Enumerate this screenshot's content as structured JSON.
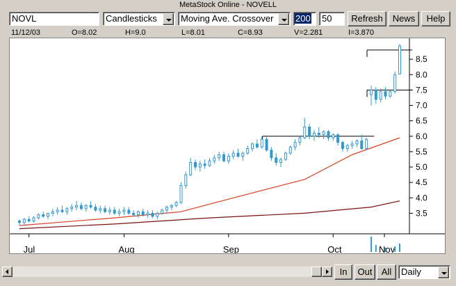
{
  "window": {
    "title": "MetaStock Online - NOVELL"
  },
  "toolbar": {
    "symbol": "NOVL",
    "chart_style": "Candlesticks",
    "indicator": "Moving Ave. Crossover",
    "period_long": "200",
    "period_short": "50",
    "refresh_label": "Refresh",
    "news_label": "News",
    "help_label": "Help"
  },
  "info_bar": {
    "date": "11/12/03",
    "open": "O=8.02",
    "high": "H=9.0",
    "low": "L=8.01",
    "close": "C=8.93",
    "volume": "V=2.281",
    "interest": "I=3.870"
  },
  "bottom_bar": {
    "in_label": "In",
    "out_label": "Out",
    "all_label": "All",
    "period": "Daily"
  },
  "colors": {
    "candle": "#3399cc",
    "ma_fast": "#d84020",
    "ma_slow": "#7a1010"
  },
  "chart_data": {
    "type": "candlestick",
    "title": "",
    "x_ticks": [
      "Jul",
      "Aug",
      "Sep",
      "Oct",
      "Nov"
    ],
    "y_ticks": [
      "8.5",
      "8.0",
      "7.5",
      "7.0",
      "6.5",
      "6.0",
      "5.5",
      "5.0",
      "4.5",
      "4.0",
      "3.5"
    ],
    "ylim": [
      2.9,
      9.0
    ],
    "grid": false,
    "candles": [
      [
        3.25,
        3.3,
        3.1,
        3.2
      ],
      [
        3.2,
        3.35,
        3.1,
        3.3
      ],
      [
        3.3,
        3.4,
        3.2,
        3.25
      ],
      [
        3.25,
        3.4,
        3.2,
        3.35
      ],
      [
        3.35,
        3.5,
        3.3,
        3.45
      ],
      [
        3.45,
        3.55,
        3.35,
        3.4
      ],
      [
        3.4,
        3.5,
        3.3,
        3.5
      ],
      [
        3.5,
        3.65,
        3.4,
        3.55
      ],
      [
        3.55,
        3.7,
        3.45,
        3.6
      ],
      [
        3.6,
        3.75,
        3.5,
        3.55
      ],
      [
        3.55,
        3.7,
        3.45,
        3.65
      ],
      [
        3.65,
        3.8,
        3.55,
        3.7
      ],
      [
        3.7,
        3.9,
        3.6,
        3.75
      ],
      [
        3.75,
        3.85,
        3.6,
        3.65
      ],
      [
        3.65,
        3.8,
        3.55,
        3.75
      ],
      [
        3.75,
        3.9,
        3.65,
        3.7
      ],
      [
        3.7,
        3.8,
        3.55,
        3.6
      ],
      [
        3.6,
        3.75,
        3.5,
        3.65
      ],
      [
        3.65,
        3.75,
        3.5,
        3.55
      ],
      [
        3.55,
        3.7,
        3.45,
        3.6
      ],
      [
        3.6,
        3.7,
        3.45,
        3.5
      ],
      [
        3.5,
        3.65,
        3.4,
        3.55
      ],
      [
        3.55,
        3.7,
        3.45,
        3.6
      ],
      [
        3.6,
        3.7,
        3.45,
        3.5
      ],
      [
        3.5,
        3.6,
        3.4,
        3.45
      ],
      [
        3.45,
        3.6,
        3.35,
        3.55
      ],
      [
        3.55,
        3.65,
        3.4,
        3.45
      ],
      [
        3.45,
        3.6,
        3.35,
        3.5
      ],
      [
        3.5,
        3.6,
        3.35,
        3.4
      ],
      [
        3.4,
        3.55,
        3.3,
        3.5
      ],
      [
        3.5,
        3.65,
        3.45,
        3.6
      ],
      [
        3.6,
        3.75,
        3.5,
        3.7
      ],
      [
        3.7,
        3.8,
        3.6,
        3.75
      ],
      [
        3.75,
        3.9,
        3.7,
        3.85
      ],
      [
        3.85,
        4.5,
        3.8,
        4.4
      ],
      [
        4.4,
        4.85,
        4.3,
        4.75
      ],
      [
        4.75,
        5.3,
        4.7,
        5.15
      ],
      [
        5.15,
        5.25,
        4.9,
        5.0
      ],
      [
        5.0,
        5.2,
        4.85,
        5.1
      ],
      [
        5.1,
        5.25,
        4.95,
        5.05
      ],
      [
        5.05,
        5.3,
        5.0,
        5.2
      ],
      [
        5.2,
        5.4,
        5.1,
        5.3
      ],
      [
        5.3,
        5.5,
        5.2,
        5.4
      ],
      [
        5.4,
        5.5,
        5.15,
        5.2
      ],
      [
        5.2,
        5.45,
        5.1,
        5.35
      ],
      [
        5.35,
        5.55,
        5.25,
        5.45
      ],
      [
        5.45,
        5.6,
        5.3,
        5.35
      ],
      [
        5.35,
        5.5,
        5.2,
        5.45
      ],
      [
        5.45,
        5.7,
        5.4,
        5.6
      ],
      [
        5.6,
        5.8,
        5.5,
        5.75
      ],
      [
        5.75,
        5.9,
        5.6,
        5.65
      ],
      [
        5.65,
        6.0,
        5.6,
        5.9
      ],
      [
        5.9,
        6.0,
        5.5,
        5.55
      ],
      [
        5.55,
        5.65,
        5.2,
        5.3
      ],
      [
        5.3,
        5.45,
        5.05,
        5.15
      ],
      [
        5.15,
        5.3,
        5.0,
        5.25
      ],
      [
        5.25,
        5.5,
        5.2,
        5.45
      ],
      [
        5.45,
        5.7,
        5.4,
        5.65
      ],
      [
        5.65,
        5.9,
        5.55,
        5.8
      ],
      [
        5.8,
        6.0,
        5.7,
        5.95
      ],
      [
        5.95,
        6.6,
        5.9,
        6.3
      ],
      [
        6.3,
        6.4,
        5.9,
        6.0
      ],
      [
        6.0,
        6.2,
        5.85,
        6.1
      ],
      [
        6.1,
        6.3,
        5.95,
        6.05
      ],
      [
        6.05,
        6.2,
        5.9,
        6.15
      ],
      [
        6.15,
        6.2,
        5.85,
        5.95
      ],
      [
        5.95,
        6.1,
        5.85,
        6.05
      ],
      [
        6.05,
        6.1,
        5.7,
        5.8
      ],
      [
        5.8,
        5.85,
        5.5,
        5.6
      ],
      [
        5.6,
        5.75,
        5.5,
        5.7
      ],
      [
        5.7,
        5.85,
        5.6,
        5.75
      ],
      [
        5.75,
        5.9,
        5.65,
        5.85
      ],
      [
        5.85,
        6.05,
        5.55,
        5.6
      ],
      [
        5.6,
        5.95,
        5.55,
        5.9
      ],
      [
        7.35,
        7.65,
        7.0,
        7.5
      ],
      [
        7.5,
        7.6,
        7.05,
        7.2
      ],
      [
        7.2,
        7.55,
        7.1,
        7.45
      ],
      [
        7.45,
        7.6,
        7.2,
        7.3
      ],
      [
        7.3,
        7.5,
        7.25,
        7.45
      ],
      [
        7.45,
        8.1,
        7.4,
        8.0
      ],
      [
        8.02,
        9.0,
        8.01,
        8.93
      ]
    ],
    "moving_average_fast": [
      [
        0,
        3.1
      ],
      [
        20,
        3.35
      ],
      [
        34,
        3.55
      ],
      [
        45,
        4.0
      ],
      [
        60,
        4.6
      ],
      [
        70,
        5.4
      ],
      [
        80,
        5.95
      ]
    ],
    "moving_average_slow": [
      [
        0,
        3.0
      ],
      [
        20,
        3.15
      ],
      [
        40,
        3.35
      ],
      [
        60,
        3.5
      ],
      [
        74,
        3.7
      ],
      [
        80,
        3.9
      ]
    ],
    "crossover_markers": [
      {
        "level": 6.0,
        "from_bar": 52,
        "to_bar": 72
      },
      {
        "level": 7.5,
        "from_bar": 74,
        "to_bar": 80
      },
      {
        "level": 8.8,
        "from_bar": 74,
        "to_bar": 80
      }
    ]
  }
}
